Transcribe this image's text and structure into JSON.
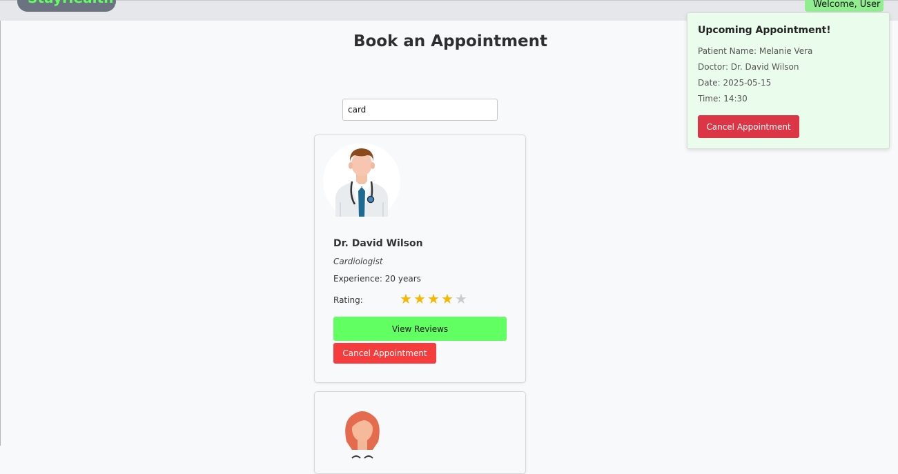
{
  "nav": {
    "logo": "StayHealthy",
    "mark": "˄˄",
    "welcome": "Welcome, User"
  },
  "page": {
    "title": "Book an Appointment"
  },
  "search": {
    "value": "card"
  },
  "doctors": [
    {
      "name": "Dr. David Wilson",
      "speciality": "Cardiologist",
      "experience": "Experience: 20 years",
      "rating_label": "Rating:",
      "rating": 4,
      "rating_max": 5,
      "view_reviews_label": "View Reviews",
      "cancel_label": "Cancel Appointment"
    }
  ],
  "popup": {
    "title": "Upcoming Appointment!",
    "patient": "Patient Name: Melanie Vera",
    "doctor": "Doctor: Dr. David Wilson",
    "date": "Date: 2025-05-15",
    "time": "Time: 14:30",
    "cancel_label": "Cancel Appointment"
  },
  "icons": {
    "avatar_male": "doctor-male-avatar",
    "avatar_female": "doctor-female-avatar",
    "star": "star-icon"
  },
  "colors": {
    "logo": "#62ff62",
    "welcome_bg": "#90ee90",
    "reviews_button": "#62ff62",
    "cancel_card": "#f53d3d",
    "cancel_popup": "#dc3545",
    "popup_bg": "#eafceb",
    "star_on": "#f5b700",
    "star_off": "#cccccc"
  }
}
